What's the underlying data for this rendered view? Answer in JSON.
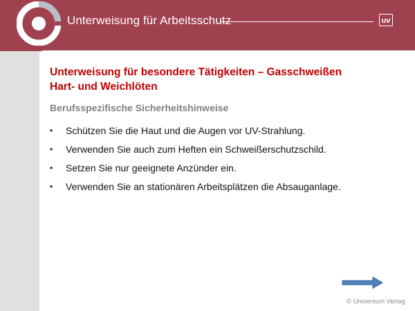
{
  "header": {
    "title": "Unterweisung für Arbeitsschutz",
    "badge": "uv"
  },
  "slide": {
    "title_line1": "Unterweisung für besondere Tätigkeiten – Gasschweißen",
    "title_line2": "Hart- und Weichlöten",
    "subtitle": "Berufsspezifische Sicherheitshinweise",
    "bullet_symbol": "•",
    "bullets": [
      "Schützen Sie die Haut und die Augen vor UV-Strahlung.",
      "Verwenden Sie auch zum Heften ein Schweißerschutzschild.",
      "Setzen Sie nur geeignete Anzünder ein.",
      "Verwenden Sie an stationären Arbeitsplätzen die Absauganlage."
    ]
  },
  "footer": {
    "copyright": "© Universum Verlag",
    "next_icon": "arrow-right-icon"
  },
  "colors": {
    "header_bg": "#a0414f",
    "title_red": "#c00000",
    "subtitle_gray": "#7f7f7f",
    "arrow_blue": "#4f81bd"
  }
}
